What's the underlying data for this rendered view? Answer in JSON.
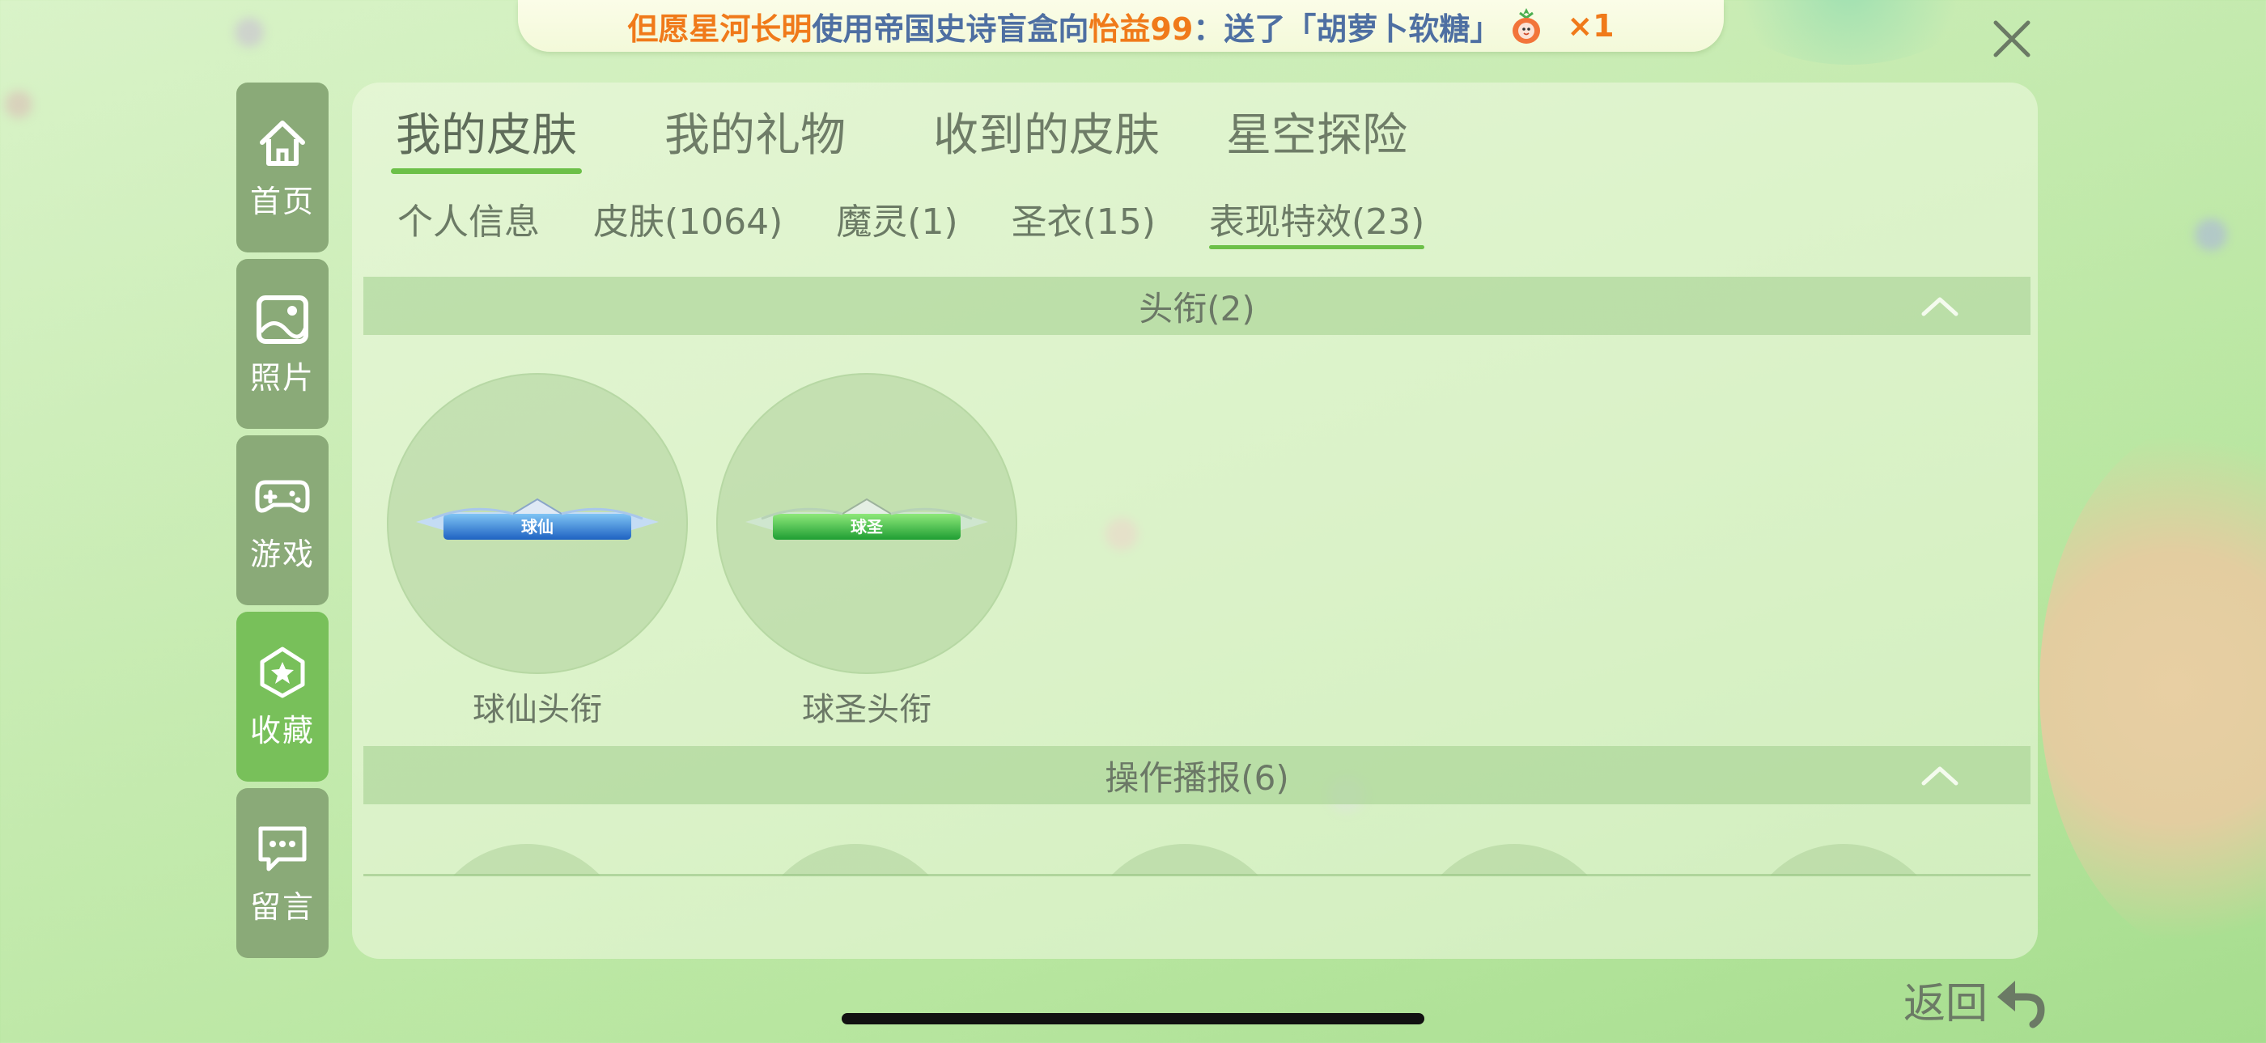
{
  "marquee": {
    "name1": "但愿星河长明",
    "text1": "使用帝国史诗盲盒向",
    "name2": "怡益99",
    "text2": "：送了「胡萝卜软糖」",
    "gift_icon": "carrot-candy-icon",
    "count": "×1"
  },
  "close_icon": "close-icon",
  "sidebar": {
    "items": [
      {
        "label": "首页",
        "icon": "home-icon"
      },
      {
        "label": "照片",
        "icon": "photo-icon"
      },
      {
        "label": "游戏",
        "icon": "gamepad-icon"
      },
      {
        "label": "收藏",
        "icon": "star-badge-icon",
        "active": true
      },
      {
        "label": "留言",
        "icon": "message-icon"
      }
    ]
  },
  "main_tabs": [
    {
      "label": "我的皮肤",
      "active": true
    },
    {
      "label": "我的礼物"
    },
    {
      "label": "收到的皮肤"
    },
    {
      "label": "星空探险"
    }
  ],
  "sub_tabs": [
    {
      "label": "个人信息"
    },
    {
      "label": "皮肤(1064)"
    },
    {
      "label": "魔灵(1)"
    },
    {
      "label": "圣衣(15)"
    },
    {
      "label": "表现特效(23)",
      "active": true
    }
  ],
  "sections": {
    "titles": {
      "header": "头衔(2)",
      "items": [
        {
          "label": "球仙头衔",
          "badge_text": "球仙",
          "color": "#3a86d8"
        },
        {
          "label": "球圣头衔",
          "badge_text": "球圣",
          "color": "#2fb944"
        }
      ]
    },
    "broadcast": {
      "header": "操作播报(6)"
    }
  },
  "back": {
    "label": "返回",
    "icon": "back-arrow-icon"
  },
  "colors": {
    "accent_green": "#6cc048",
    "sidebar_bg": "#8aaa78",
    "sidebar_active": "#78c05a",
    "marquee_name": "#f07a1a",
    "marquee_text": "#4e6fa2"
  }
}
